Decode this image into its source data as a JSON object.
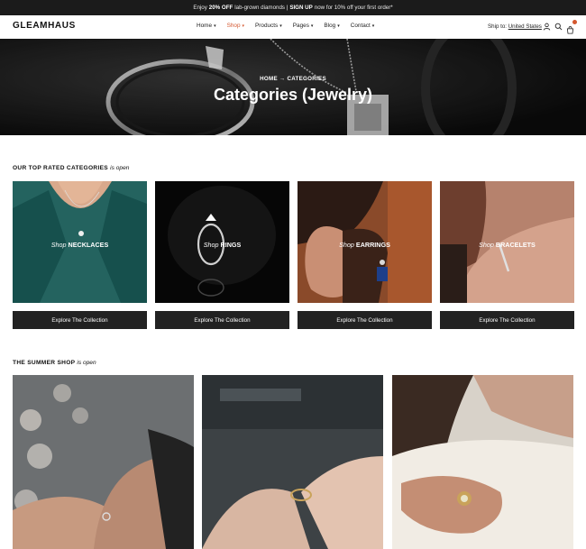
{
  "announcement": {
    "pre": "Enjoy",
    "discount": "20% OFF",
    "mid": "lab-grown diamonds |",
    "signup": "SIGN UP",
    "post": "now for 10% off your first order*"
  },
  "header": {
    "logo": "GLEAMHAUS",
    "nav": [
      {
        "label": "Home",
        "caret": "▾"
      },
      {
        "label": "Shop",
        "caret": "▾"
      },
      {
        "label": "Products",
        "caret": "▾"
      },
      {
        "label": "Pages",
        "caret": "▾"
      },
      {
        "label": "Blog",
        "caret": "▾"
      },
      {
        "label": "Contact",
        "caret": "▾"
      }
    ],
    "ship_to_label": "Ship to:",
    "ship_to_country": "United States",
    "icons": [
      "user-icon",
      "search-icon",
      "cart-icon"
    ]
  },
  "hero": {
    "breadcrumb_home": "HOME",
    "breadcrumb_sep": "→",
    "breadcrumb_current": "CATEGORIES",
    "title": "Categories (Jewelry)"
  },
  "top_rated": {
    "title": "OUR TOP RATED CATEGORIES",
    "suffix": "is open",
    "cards": [
      {
        "prefix": "Shop",
        "name": "NECKLACES",
        "button": "Explore The Collection"
      },
      {
        "prefix": "Shop",
        "name": "RINGS",
        "button": "Explore The Collection"
      },
      {
        "prefix": "Shop",
        "name": "EARRINGS",
        "button": "Explore The Collection"
      },
      {
        "prefix": "Shop",
        "name": "BRACELETS",
        "button": "Explore The Collection"
      }
    ]
  },
  "summer": {
    "title": "THE SUMMER SHOP",
    "suffix": "is open"
  },
  "colors": {
    "accent": "#d4572e",
    "dark": "#222222",
    "topbar": "#1b1b1b"
  }
}
